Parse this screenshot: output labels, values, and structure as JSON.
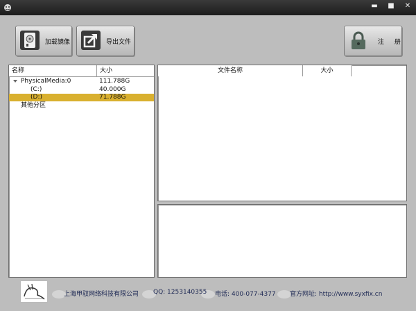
{
  "window": {
    "title": "",
    "min_glyph": "▬",
    "max_glyph": "■",
    "close_glyph": "✕"
  },
  "toolbar": {
    "load_label": "加载镜像",
    "export_label": "导出文件",
    "register_label": "注 册"
  },
  "tree": {
    "columns": [
      "名称",
      "大小"
    ],
    "rows": [
      {
        "name": "PhysicalMedia:0",
        "size": "111.788G",
        "selected": false
      },
      {
        "name": "(C:)",
        "size": "40.000G",
        "selected": false
      },
      {
        "name": "(D:)",
        "size": "71.788G",
        "selected": true
      },
      {
        "name": "其他分区",
        "size": "",
        "selected": false
      }
    ]
  },
  "file_list": {
    "columns": [
      "文件名称",
      "大小"
    ]
  },
  "footer": {
    "company": "上海甲驭网络科技有限公司",
    "qq": "QQ: 1253140355",
    "phone": "电话: 400-077-4377",
    "site": "官方网址: http://www.syxfix.cn"
  },
  "colors": {
    "selection": "#d9b02f",
    "window_bg": "#bdbdbd",
    "titlebar": "#2a2a2a"
  },
  "icons": [
    "app-icon",
    "hard-disk-icon",
    "export-arrow-icon",
    "padlock-icon",
    "company-logo"
  ]
}
